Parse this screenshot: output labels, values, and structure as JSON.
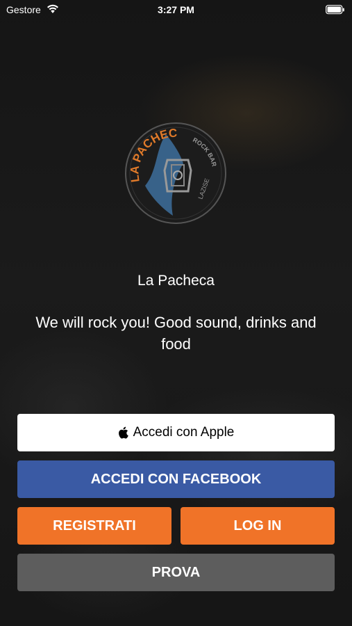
{
  "status_bar": {
    "carrier": "Gestore",
    "time": "3:27 PM"
  },
  "logo": {
    "title": "LA PACHECA",
    "subtitle": "ROCK BAR",
    "location": "LAZISE"
  },
  "app_name": "La Pacheca",
  "tagline": "We will rock you! Good sound, drinks and food",
  "buttons": {
    "apple": "Accedi con Apple",
    "facebook": "ACCEDI CON FACEBOOK",
    "register": "REGISTRATI",
    "login": "LOG IN",
    "trial": "PROVA"
  },
  "colors": {
    "facebook": "#3a5aa4",
    "accent_orange": "#f07328",
    "trial_gray": "#5d5d5d",
    "logo_blue": "#3d6f9c",
    "logo_orange": "#e07a2a"
  },
  "icons": [
    "wifi-icon",
    "battery-icon",
    "apple-icon",
    "engine-icon"
  ]
}
